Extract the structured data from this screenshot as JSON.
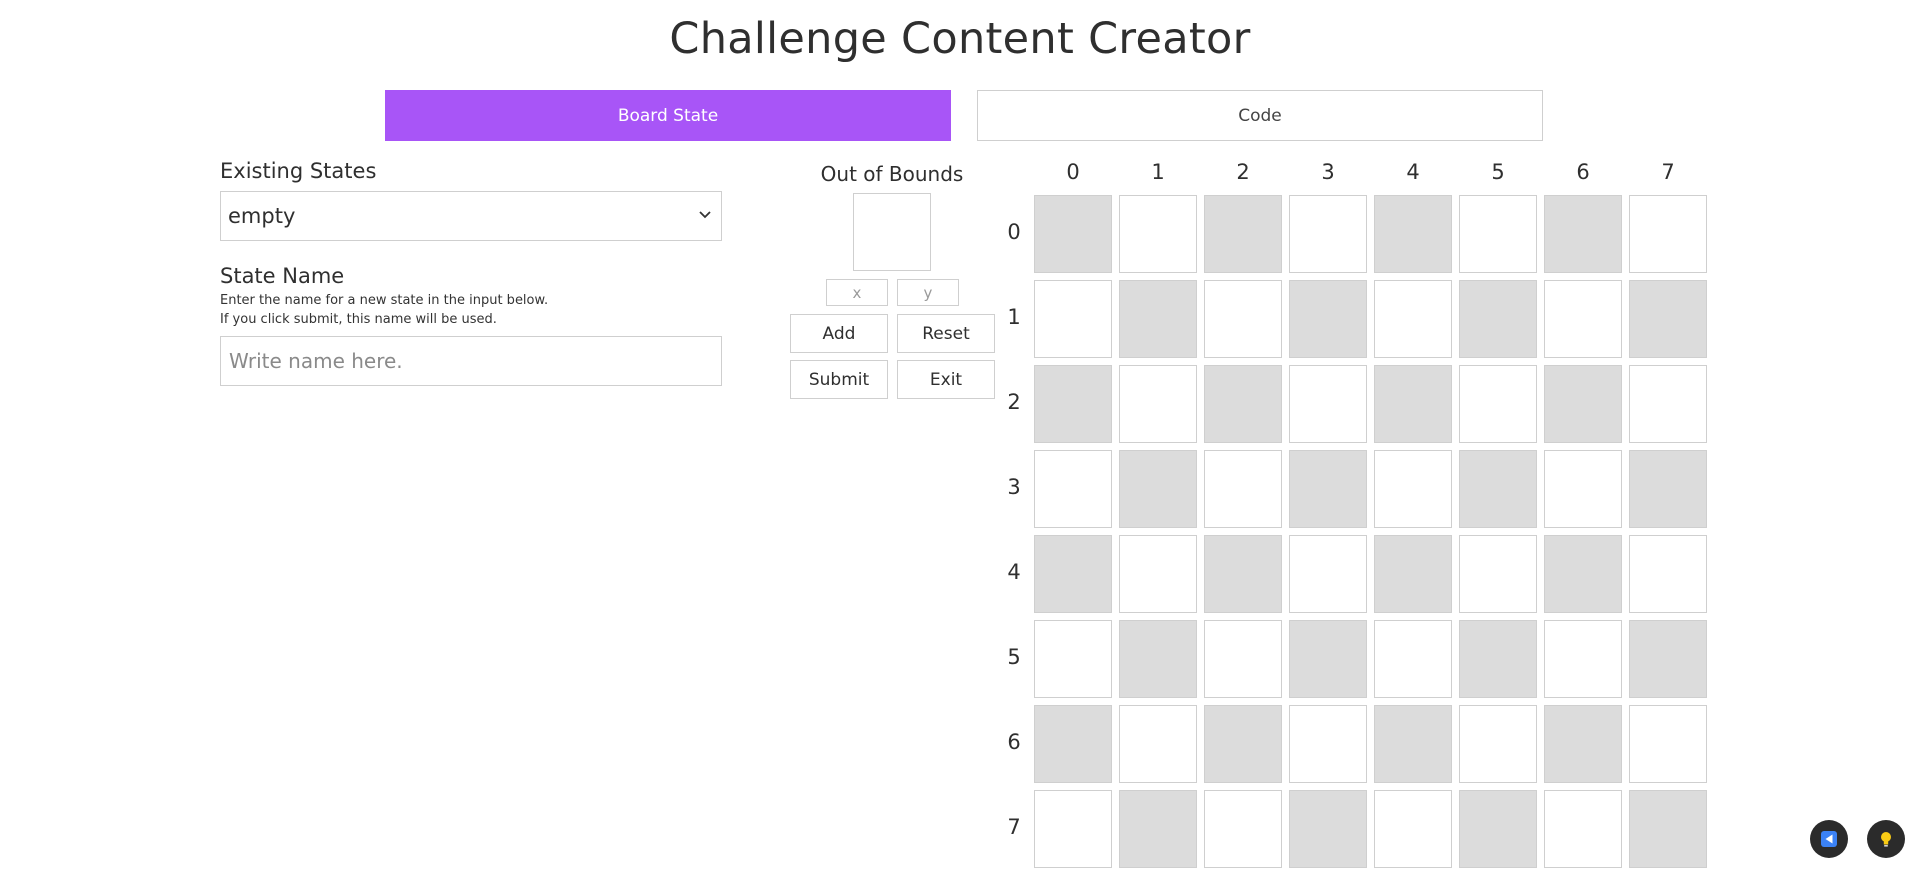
{
  "header": {
    "title": "Challenge Content Creator"
  },
  "tabs": [
    {
      "label": "Board State",
      "active": true
    },
    {
      "label": "Code",
      "active": false
    }
  ],
  "existing_states": {
    "label": "Existing States",
    "selected": "empty"
  },
  "state_name": {
    "label": "State Name",
    "hint_line1": "Enter the name for a new state in the input below.",
    "hint_line2": "If you click submit, this name will be used.",
    "placeholder": "Write name here."
  },
  "out_of_bounds": {
    "label": "Out of Bounds",
    "x_placeholder": "x",
    "y_placeholder": "y"
  },
  "controls": {
    "add": "Add",
    "reset": "Reset",
    "submit": "Submit",
    "exit": "Exit"
  },
  "board": {
    "columns": [
      "0",
      "1",
      "2",
      "3",
      "4",
      "5",
      "6",
      "7"
    ],
    "rows": [
      "0",
      "1",
      "2",
      "3",
      "4",
      "5",
      "6",
      "7"
    ]
  },
  "colors": {
    "accent": "#a855f7",
    "dark_cell": "#dcdcdc",
    "light_cell": "#ffffff",
    "border": "#cfcfcf"
  },
  "icons": {
    "left_fab": "send-icon",
    "right_fab": "lightbulb-icon"
  }
}
